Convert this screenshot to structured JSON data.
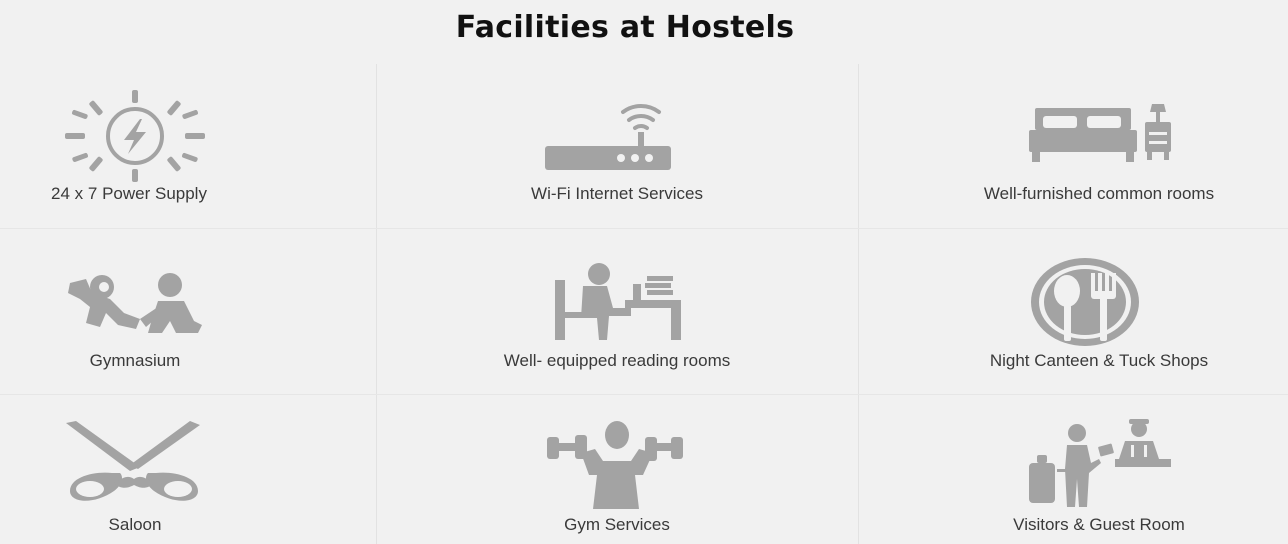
{
  "page": {
    "title": "Facilities at Hostels"
  },
  "colors": {
    "background": "#f1f1f1",
    "icon": "#a3a3a3",
    "icon_dark": "#8f8f8f",
    "text": "#3a3a3a",
    "title": "#111111",
    "divider": "#e2e2e2"
  },
  "facilities": [
    {
      "label": "24 x 7 Power Supply",
      "icon": "sun-bolt-icon"
    },
    {
      "label": "Wi-Fi Internet Services",
      "icon": "wifi-router-icon"
    },
    {
      "label": "Well-furnished common rooms",
      "icon": "bed-icon"
    },
    {
      "label": "Gymnasium",
      "icon": "exercise-people-icon"
    },
    {
      "label": "Well- equipped reading rooms",
      "icon": "reading-desk-icon"
    },
    {
      "label": "Night Canteen & Tuck Shops",
      "icon": "plate-cutlery-icon"
    },
    {
      "label": "Saloon",
      "icon": "scissors-mustache-icon"
    },
    {
      "label": "Gym Services",
      "icon": "dumbbell-lifter-icon"
    },
    {
      "label": "Visitors & Guest Room",
      "icon": "reception-guest-icon"
    }
  ]
}
